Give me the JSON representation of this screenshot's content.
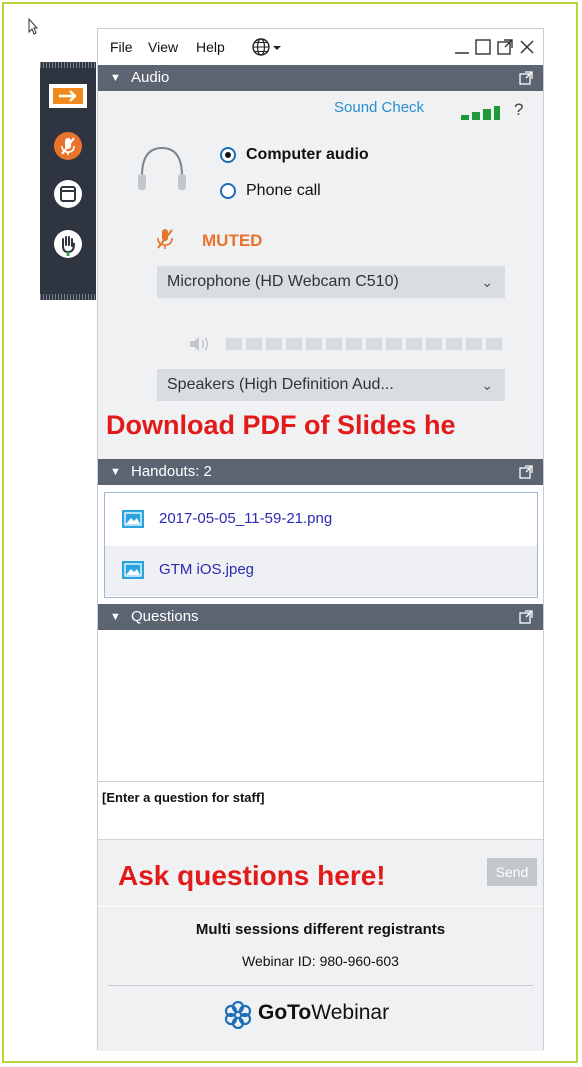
{
  "menu": {
    "file": "File",
    "view": "View",
    "help": "Help"
  },
  "audio": {
    "header": "Audio",
    "sound_check": "Sound Check",
    "help": "?",
    "option_computer": "Computer audio",
    "option_phone": "Phone call",
    "selected_option": "Computer audio",
    "muted_label": "MUTED",
    "microphone": "Microphone (HD Webcam C510)",
    "speakers": "Speakers (High Definition Aud..."
  },
  "overlays": {
    "download_note": "Download PDF of Slides he",
    "ask_note": "Ask questions here!"
  },
  "handouts": {
    "header": "Handouts: 2",
    "files": [
      "2017-05-05_11-59-21.png",
      "GTM iOS.jpeg"
    ]
  },
  "questions": {
    "header": "Questions",
    "input_placeholder": "[Enter a question for staff]",
    "send_label": "Send"
  },
  "session": {
    "title": "Multi sessions different registrants",
    "webinar_id": "Webinar ID: 980-960-603"
  },
  "brand": {
    "part1": "GoTo",
    "part2": "Webinar"
  },
  "colors": {
    "accent_blue": "#2a8fd1",
    "muted_orange": "#e8732a",
    "header_gray": "#5c6371",
    "overlay_red": "#e21a1a"
  }
}
